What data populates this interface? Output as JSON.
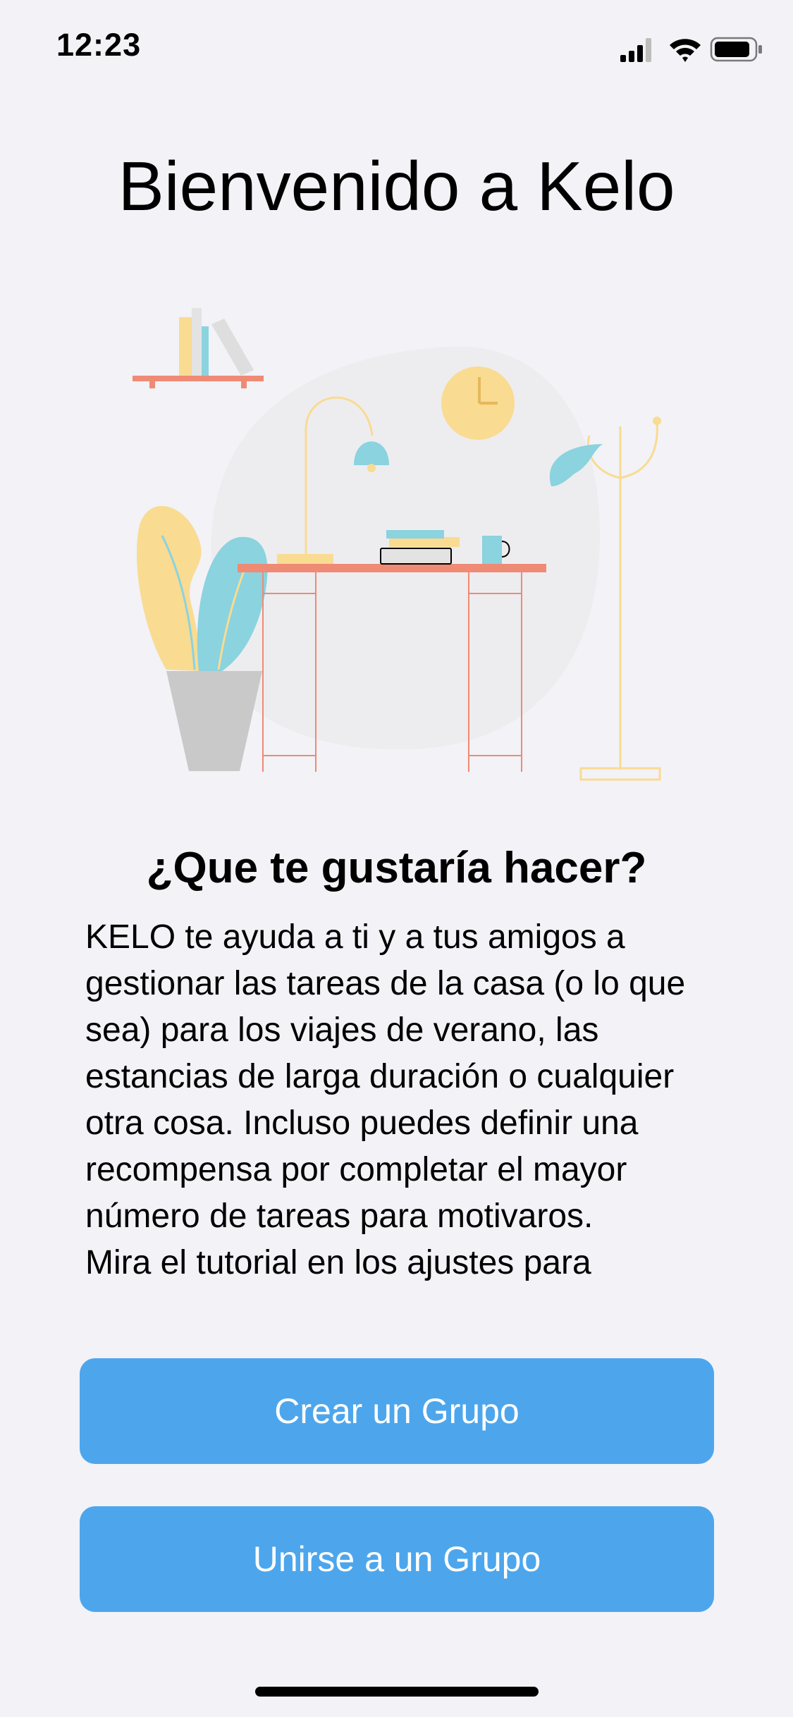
{
  "status_bar": {
    "time": "12:23",
    "icons": [
      "cellular-signal-icon",
      "wifi-icon",
      "battery-icon"
    ]
  },
  "welcome": {
    "title": "Bienvenido a Kelo"
  },
  "illustration": {
    "name": "desk-workspace-illustration"
  },
  "intro": {
    "question": "¿Que te gustaría hacer?",
    "description": "KELO te ayuda a ti y a tus amigos a gestionar las tareas de la casa (o lo que sea) para los viajes de verano, las estancias de larga duración o cualquier otra cosa. Incluso puedes definir una recompensa por completar el mayor número de tareas para motivaros.",
    "tutorial_hint": "Mira el tutorial en los ajustes para"
  },
  "actions": {
    "create_group": "Crear un Grupo",
    "join_group": "Unirse a un Grupo"
  },
  "colors": {
    "background": "#F2F2F7",
    "button": "#4DA6EC",
    "button_text": "#FFFFFF",
    "accent_coral": "#EF8A74",
    "accent_yellow": "#F9DB92",
    "accent_teal": "#8AD3DF"
  }
}
